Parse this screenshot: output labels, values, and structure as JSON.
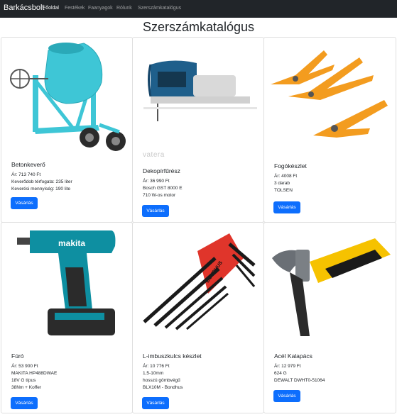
{
  "navbar": {
    "brand": "Barkácsbolt",
    "links": [
      "Főoldal",
      "Festékek",
      "Faanyagok",
      "Rólunk",
      "Szerszámkatalógus"
    ]
  },
  "page": {
    "title": "Szerszámkatalógus"
  },
  "products": [
    {
      "title": "Betonkeverő",
      "lines": [
        "Ár: 713 740 Ft",
        "Keverődob térfogata: 235 liter",
        "Keverési mennyiség: 190 lite"
      ],
      "button": "Vásárlás"
    },
    {
      "title": "Dekopírfűrész",
      "lines": [
        "Ár: 36 990 Ft",
        "Bosch GST 8000 E",
        "710 W-os motor"
      ],
      "button": "Vásárlás",
      "image_text": "vatera"
    },
    {
      "title": "Fogókészlet",
      "lines": [
        "Ár: 4008 Ft",
        "3 darab",
        "TOLSEN"
      ],
      "button": "Vásárlás"
    },
    {
      "title": "Fúró",
      "lines": [
        "Ár: 53 900 Ft",
        "MAKITA HP488DWAE",
        "18V G típus",
        "38Nm + Koffer"
      ],
      "button": "Vásárlás",
      "image_text": "makita"
    },
    {
      "title": "L-imbuszkulcs készlet",
      "lines": [
        "Ár: 10 776 Ft",
        "1,5-10mm",
        "hosszú gömbvégű",
        "BLX10M - Bondhus"
      ],
      "button": "Vásárlás",
      "image_text": "BONDHUS"
    },
    {
      "title": "Acél Kalapács",
      "lines": [
        "Ár: 12 979 Ft",
        "624 G",
        "DEWALT DWHT0-51064"
      ],
      "button": "Vásárlás"
    }
  ],
  "colors": {
    "navbar": "#212529",
    "button": "#0d6efd",
    "mixer": "#3ec6d6",
    "bosch_blue": "#1f5f8b",
    "pliers_orange": "#f39c1f",
    "makita_teal": "#0e8fa1",
    "hex_red": "#e0352b",
    "dewalt_yellow": "#f6c200"
  }
}
